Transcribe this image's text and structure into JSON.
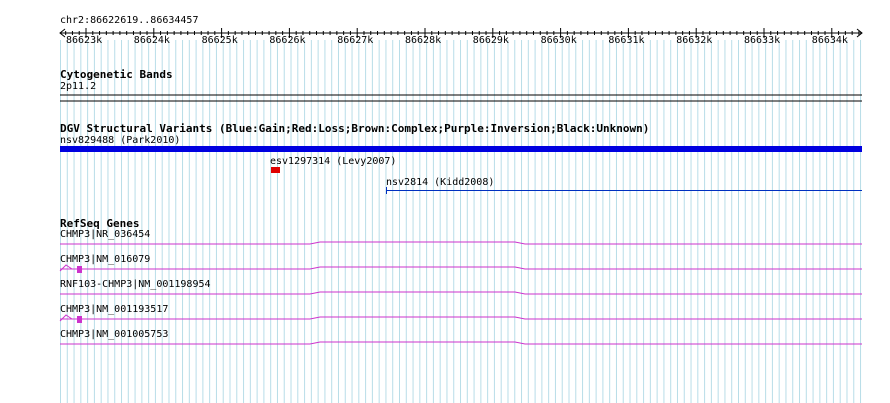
{
  "ruler": {
    "region": "chr2:86622619..86634457",
    "ticks": [
      "86623k",
      "86624k",
      "86625k",
      "86626k",
      "86627k",
      "86628k",
      "86629k",
      "86630k",
      "86631k",
      "86632k",
      "86633k",
      "86634k"
    ]
  },
  "cytoband": {
    "title": "Cytogenetic Bands",
    "band": "2p11.2"
  },
  "dgv": {
    "title": "DGV Structural Variants (Blue:Gain;Red:Loss;Brown:Complex;Purple:Inversion;Black:Unknown)",
    "variants": [
      {
        "label": "nsv829488 (Park2010)",
        "color": "#0000e0"
      },
      {
        "label": "esv1297314 (Levy2007)",
        "color": "#e00000"
      },
      {
        "label": "nsv2814 (Kidd2008)",
        "color": "#0030c0"
      }
    ]
  },
  "refseq": {
    "title": "RefSeq Genes",
    "color": "#cc33cc",
    "genes": [
      {
        "label": "CHMP3|NR_036454"
      },
      {
        "label": "CHMP3|NM_016079"
      },
      {
        "label": "RNF103-CHMP3|NM_001198954"
      },
      {
        "label": "CHMP3|NM_001193517"
      },
      {
        "label": "CHMP3|NM_001005753"
      }
    ]
  }
}
